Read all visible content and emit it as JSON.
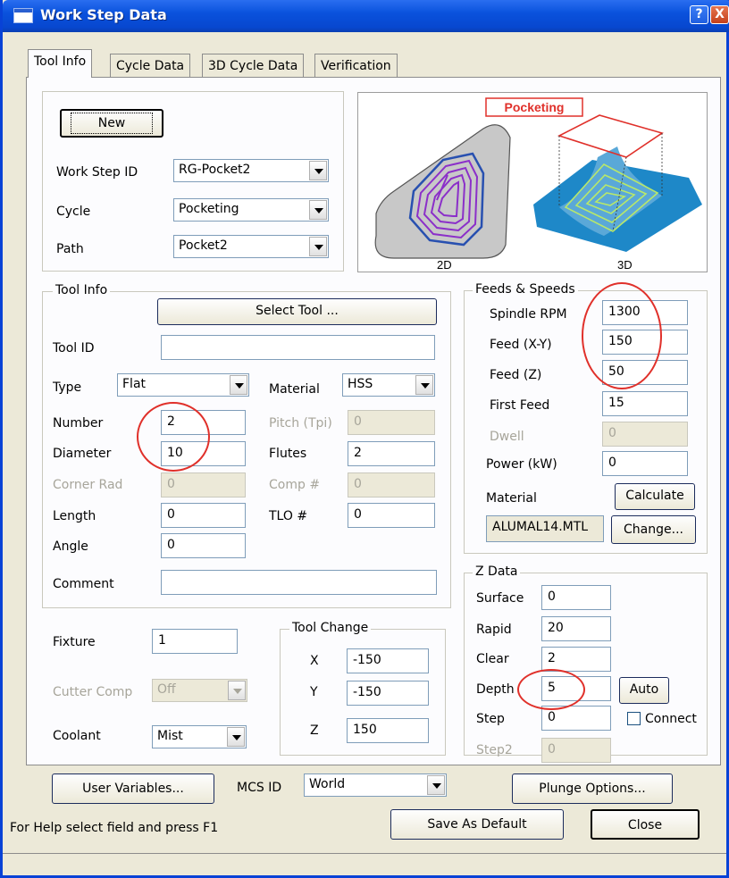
{
  "window": {
    "title": "Work Step Data",
    "help_btn": "?",
    "close_btn": "X"
  },
  "tabs": [
    {
      "label": "Tool Info",
      "active": true
    },
    {
      "label": "Cycle Data"
    },
    {
      "label": "3D Cycle Data"
    },
    {
      "label": "Verification"
    }
  ],
  "header_box": {
    "new_btn": "New",
    "rows": [
      {
        "label": "Work Step ID",
        "value": "RG-Pocket2"
      },
      {
        "label": "Cycle",
        "value": "Pocketing"
      },
      {
        "label": "Path",
        "value": "Pocket2"
      }
    ]
  },
  "preview": {
    "title": "Pocketing",
    "left_label": "2D",
    "right_label": "3D"
  },
  "tool_info": {
    "group": "Tool Info",
    "select_tool": "Select Tool ...",
    "tool_id_label": "Tool ID",
    "tool_id_value": "",
    "type_label": "Type",
    "type_value": "Flat",
    "material_label": "Material",
    "material_value": "HSS",
    "number_label": "Number",
    "number_value": "2",
    "pitch_label": "Pitch (Tpi)",
    "pitch_value": "0",
    "diameter_label": "Diameter",
    "diameter_value": "10",
    "flutes_label": "Flutes",
    "flutes_value": "2",
    "corner_label": "Corner Rad",
    "corner_value": "0",
    "comp_label": "Comp #",
    "comp_value": "0",
    "length_label": "Length",
    "length_value": "0",
    "tlo_label": "TLO #",
    "tlo_value": "0",
    "angle_label": "Angle",
    "angle_value": "0",
    "comment_label": "Comment",
    "comment_value": ""
  },
  "feeds": {
    "group": "Feeds & Speeds",
    "spindle_label": "Spindle RPM",
    "spindle_value": "1300",
    "feedxy_label": "Feed (X-Y)",
    "feedxy_value": "150",
    "feedz_label": "Feed (Z)",
    "feedz_value": "50",
    "first_label": "First Feed",
    "first_value": "15",
    "dwell_label": "Dwell",
    "dwell_value": "0",
    "power_label": "Power (kW)",
    "power_value": "0",
    "material_label": "Material",
    "calculate_btn": "Calculate",
    "material_file": "ALUMAL14.MTL",
    "change_btn": "Change..."
  },
  "zdata": {
    "group": "Z Data",
    "surface_label": "Surface",
    "surface_value": "0",
    "rapid_label": "Rapid",
    "rapid_value": "20",
    "clear_label": "Clear",
    "clear_value": "2",
    "depth_label": "Depth",
    "depth_value": "5",
    "auto_btn": "Auto",
    "step_label": "Step",
    "step_value": "0",
    "connect_label": "Connect",
    "step2_label": "Step2",
    "step2_value": "0",
    "plunge_btn": "Plunge Options..."
  },
  "lower": {
    "fixture_label": "Fixture",
    "fixture_value": "1",
    "cutter_label": "Cutter Comp",
    "cutter_value": "Off",
    "coolant_label": "Coolant",
    "coolant_value": "Mist",
    "toolchange_group": "Tool Change",
    "x_label": "X",
    "x_value": "-150",
    "y_label": "Y",
    "y_value": "-150",
    "z_label": "Z",
    "z_value": "150",
    "user_vars_btn": "User Variables...",
    "mcs_label": "MCS ID",
    "mcs_value": "World"
  },
  "status": {
    "help_text": "For Help select field and press F1",
    "save_default_btn": "Save As Default",
    "close_btn": "Close"
  },
  "colors": {
    "titlebar": "#0a52dd",
    "annotation": "#e0302a",
    "pocket_purple": "#8b2fc9",
    "surface_blue": "#1e88c8"
  }
}
